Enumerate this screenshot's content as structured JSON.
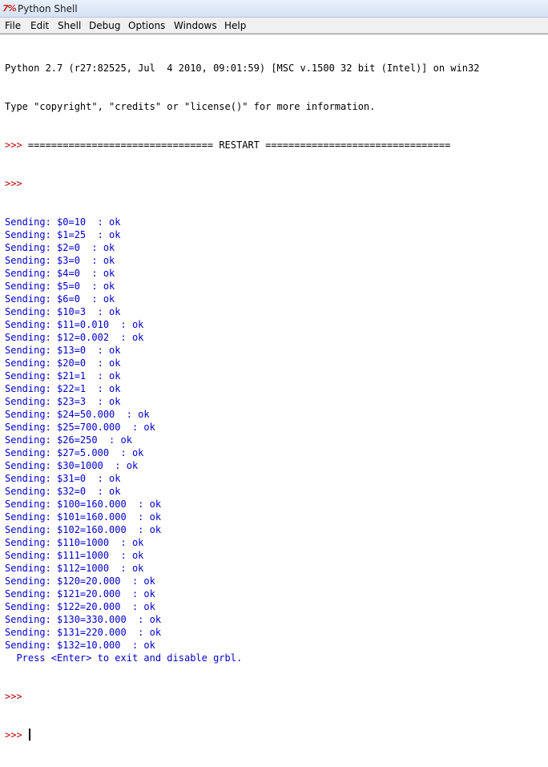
{
  "window": {
    "title": "Python Shell",
    "icon": "python-idle-icon"
  },
  "menu": [
    "File",
    "Edit",
    "Shell",
    "Debug",
    "Options",
    "Windows",
    "Help"
  ],
  "colors": {
    "stdout": "#0000cc",
    "prompt": "#c00000",
    "banner": "#000000"
  },
  "shell": {
    "banner": [
      "Python 2.7 (r27:82525, Jul  4 2010, 09:01:59) [MSC v.1500 32 bit (Intel)] on win32",
      "Type \"copyright\", \"credits\" or \"license()\" for more information."
    ],
    "restart_line": ">>> ================================ RESTART ================================",
    "prompt": ">>>",
    "output": [
      "Sending: $0=10  : ok",
      "Sending: $1=25  : ok",
      "Sending: $2=0  : ok",
      "Sending: $3=0  : ok",
      "Sending: $4=0  : ok",
      "Sending: $5=0  : ok",
      "Sending: $6=0  : ok",
      "Sending: $10=3  : ok",
      "Sending: $11=0.010  : ok",
      "Sending: $12=0.002  : ok",
      "Sending: $13=0  : ok",
      "Sending: $20=0  : ok",
      "Sending: $21=1  : ok",
      "Sending: $22=1  : ok",
      "Sending: $23=3  : ok",
      "Sending: $24=50.000  : ok",
      "Sending: $25=700.000  : ok",
      "Sending: $26=250  : ok",
      "Sending: $27=5.000  : ok",
      "Sending: $30=1000  : ok",
      "Sending: $31=0  : ok",
      "Sending: $32=0  : ok",
      "Sending: $100=160.000  : ok",
      "Sending: $101=160.000  : ok",
      "Sending: $102=160.000  : ok",
      "Sending: $110=1000  : ok",
      "Sending: $111=1000  : ok",
      "Sending: $112=1000  : ok",
      "Sending: $120=20.000  : ok",
      "Sending: $121=20.000  : ok",
      "Sending: $122=20.000  : ok",
      "Sending: $130=330.000  : ok",
      "Sending: $131=220.000  : ok",
      "Sending: $132=10.000  : ok",
      "  Press <Enter> to exit and disable grbl."
    ]
  }
}
